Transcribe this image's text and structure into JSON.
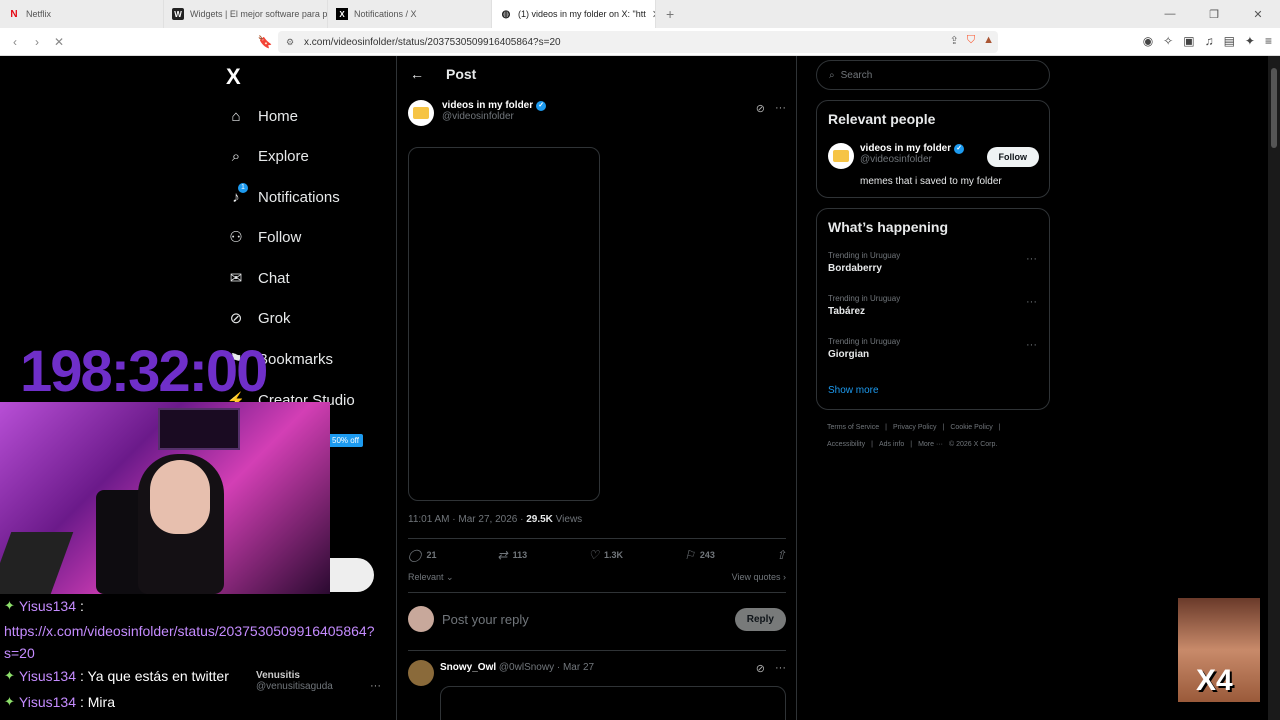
{
  "browser": {
    "tabs": [
      {
        "label": "Netflix",
        "icon": "N",
        "active": false
      },
      {
        "label": "Widgets | El mejor software para por",
        "icon": "W",
        "active": false
      },
      {
        "label": "Notifications / X",
        "icon": "X",
        "active": false
      },
      {
        "label": "(1) videos in my folder on X: \"htt",
        "icon": "•",
        "active": true
      }
    ],
    "new_tab": "+",
    "url": "x.com/videosinfolder/status/2037530509916405864?s=20"
  },
  "nav": {
    "logo": "X",
    "items": [
      {
        "label": "Home",
        "icon": "⌂"
      },
      {
        "label": "Explore",
        "icon": "⌕"
      },
      {
        "label": "Notifications",
        "icon": "🔔",
        "badge": "1"
      },
      {
        "label": "Follow",
        "icon": "👤+"
      },
      {
        "label": "Chat",
        "icon": "✉"
      },
      {
        "label": "Grok",
        "icon": "◎"
      },
      {
        "label": "Bookmarks",
        "icon": "🔖"
      },
      {
        "label": "Creator Studio",
        "icon": "⚡"
      }
    ],
    "promo": "50% off"
  },
  "post": {
    "header": "Post",
    "author_name": "videos in my folder",
    "author_handle": "@videosinfolder",
    "timestamp": "11:01 AM · Mar 27, 2026 · ",
    "views_count": "29.5K",
    "views_label": " Views",
    "replies": "21",
    "reposts": "113",
    "likes": "1.3K",
    "bookmarks": "243",
    "relevant": "Relevant",
    "view_quotes": "View quotes",
    "reply_placeholder": "Post your reply",
    "reply_button": "Reply",
    "comment": {
      "name": "Snowy_Owl",
      "handle": "@0wlSnowy",
      "date": "· Mar 27"
    }
  },
  "sidebar": {
    "search_placeholder": "Search",
    "relevant_title": "Relevant people",
    "person": {
      "name": "videos in my folder",
      "handle": "@videosinfolder",
      "bio": "memes that i saved to my folder",
      "follow": "Follow"
    },
    "happening_title": "What’s happening",
    "trends": [
      {
        "meta": "Trending in Uruguay",
        "topic": "Bordaberry"
      },
      {
        "meta": "Trending in Uruguay",
        "topic": "Tabárez"
      },
      {
        "meta": "Trending in Uruguay",
        "topic": "Giorgian"
      }
    ],
    "show_more": "Show more",
    "footer_row1": [
      "Terms of Service",
      "|",
      "Privacy Policy",
      "|",
      "Cookie Policy",
      "|"
    ],
    "footer_row2": [
      "Accessibility",
      "|",
      "Ads info",
      "|",
      "More ···",
      "© 2026 X Corp."
    ]
  },
  "overlay": {
    "timer": "198:32:00",
    "chat": [
      {
        "user": "Yisus134",
        "text": " :"
      },
      {
        "link": "https://x.com/videosinfolder/status/2037530509916405864?s=20"
      },
      {
        "user": "Yisus134",
        "text": " : Ya que estás en twitter"
      },
      {
        "user": "Yisus134",
        "text": " : Mira"
      }
    ],
    "venus_name": "Venusitis",
    "venus_handle": "@venusitisaguda",
    "meme_text": "X4"
  },
  "colors": {
    "accent": "#1d9bf0",
    "timer": "#6f2fc9",
    "chat_user": "#c58cff"
  }
}
